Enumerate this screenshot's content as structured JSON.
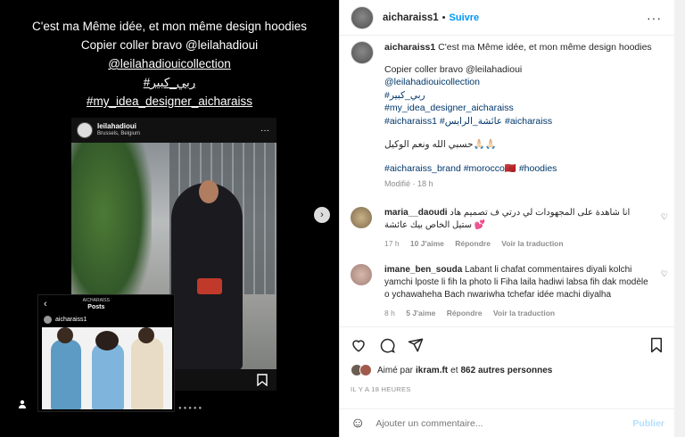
{
  "story": {
    "lines": [
      "C'est ma Même idée, et mon même design hoodies",
      "Copier coller bravo @leilahadioui",
      "@leilahadiouicollection",
      "#ربي_كبير",
      "#my_idea_designer_aicharaiss"
    ],
    "embed": {
      "username": "leilahadioui",
      "location": "Brussels, Belgium",
      "more": "···"
    },
    "overlay": {
      "back": "‹",
      "account": "AICHARAISS",
      "section": "Posts",
      "username": "aicharaiss1"
    },
    "next_arrow": "›"
  },
  "post": {
    "username": "aicharaiss1",
    "separator": "•",
    "follow_label": "Suivre",
    "more": "···",
    "caption": {
      "first_line": "C'est ma Même idée, et mon même design hoodies",
      "lines": [
        "Copier coller bravo @leilahadioui",
        "@leilahadiouicollection",
        "#ربي_كبير",
        "#my_idea_designer_aicharaiss",
        "#aicharaiss1 #عائشة_الرايس #aicharaiss",
        "",
        "حسبي الله ونعم الوكيل🙏🏻🙏🏻",
        "",
        "#aicharaiss_brand #morocco🇲🇦 #hoodies"
      ],
      "modified": "Modifié · 18 h"
    },
    "comments": [
      {
        "username": "maria__daoudi",
        "text": "انا شاهدة على المجهودات لي درتي ف تصميم هاد ستيل الخاص بيك عائشة 💕",
        "time": "17 h",
        "likes": "10 J'aime",
        "reply": "Répondre",
        "translate": "Voir la traduction"
      },
      {
        "username": "imane_ben_souda",
        "text": "Labant li chafat commentaires diyali kolchi yamchi lposte li fih la photo li Fiha laila hadiwi labsa fih dak modèle o ychawaheha Bach nwariwha tchefar idée machi diyalha",
        "time": "8 h",
        "likes": "5 J'aime",
        "reply": "Répondre",
        "translate": "Voir la traduction"
      }
    ],
    "likes_text": {
      "prefix": "Aimé par",
      "user": "ikram.ft",
      "middle": "et",
      "count": "862 autres personnes"
    },
    "timestamp": "IL Y A 18 HEURES",
    "add_comment": {
      "placeholder": "Ajouter un commentaire...",
      "publish": "Publier"
    }
  }
}
